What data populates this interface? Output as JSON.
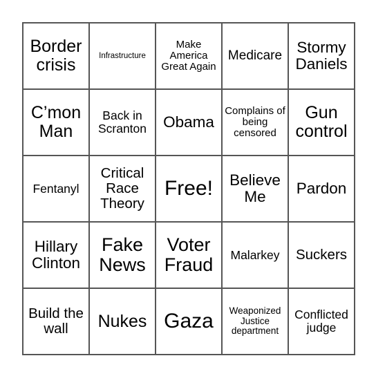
{
  "card": {
    "rows": [
      [
        "Border crisis",
        "Infrastructure",
        "Make America Great Again",
        "Medicare",
        "Stormy Daniels"
      ],
      [
        "C’mon Man",
        "Back in Scranton",
        "Obama",
        "Complains of being censored",
        "Gun control"
      ],
      [
        "Fentanyl",
        "Critical Race Theory",
        "Free!",
        "Believe Me",
        "Pardon"
      ],
      [
        "Hillary Clinton",
        "Fake News",
        "Voter Fraud",
        "Malarkey",
        "Suckers"
      ],
      [
        "Build the wall",
        "Nukes",
        "Gaza",
        "Weaponized Justice department",
        "Conflicted judge"
      ]
    ],
    "free_space": "Free!"
  }
}
